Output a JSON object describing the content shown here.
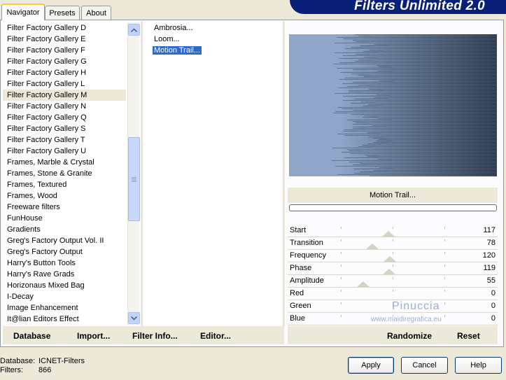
{
  "app_title": "Filters Unlimited 2.0",
  "tabs": [
    "Navigator",
    "Presets",
    "About"
  ],
  "categories": [
    "Filter Factory Gallery D",
    "Filter Factory Gallery E",
    "Filter Factory Gallery F",
    "Filter Factory Gallery G",
    "Filter Factory Gallery H",
    "Filter Factory Gallery L",
    "Filter Factory Gallery M",
    "Filter Factory Gallery N",
    "Filter Factory Gallery Q",
    "Filter Factory Gallery S",
    "Filter Factory Gallery T",
    "Filter Factory Gallery U",
    "Frames, Marble & Crystal",
    "Frames, Stone & Granite",
    "Frames, Textured",
    "Frames, Wood",
    "Freeware filters",
    "FunHouse",
    "Gradients",
    "Greg's Factory Output Vol. II",
    "Greg's Factory Output",
    "Harry's Button Tools",
    "Harry's Rave Grads",
    "Horizonaus Mixed Bag",
    "I-Decay",
    "Image Enhancement",
    "It@lian Editors Effect"
  ],
  "selected_category": "Filter Factory Gallery M",
  "filters": [
    "Ambrosia...",
    "Loom...",
    "Motion Trail..."
  ],
  "selected_filter": "Motion Trail...",
  "effect_name": "Motion Trail...",
  "params": [
    {
      "label": "Start",
      "value": "117",
      "level": 117
    },
    {
      "label": "Transition",
      "value": "78",
      "level": 78
    },
    {
      "label": "Frequency",
      "value": "120",
      "level": 120
    },
    {
      "label": "Phase",
      "value": "119",
      "level": 119
    },
    {
      "label": "Amplitude",
      "value": "55",
      "level": 55
    },
    {
      "label": "Red",
      "value": "0",
      "level": 0
    },
    {
      "label": "Green",
      "value": "0",
      "level": 0
    },
    {
      "label": "Blue",
      "value": "0",
      "level": 0
    }
  ],
  "watermark": {
    "name": "Pinuccia",
    "url": "www.maidiregrafica.eu"
  },
  "left_buttons": {
    "database": "Database",
    "import": "Import...",
    "filter_info": "Filter Info...",
    "editor": "Editor..."
  },
  "right_buttons": {
    "randomize": "Randomize",
    "reset": "Reset"
  },
  "status": {
    "database_label": "Database:",
    "database_value": "ICNET-Filters",
    "filters_label": "Filters:",
    "filters_value": "866"
  },
  "dialog_buttons": {
    "apply": "Apply",
    "cancel": "Cancel",
    "help": "Help"
  },
  "colors": {
    "banner": "#0a1f78",
    "selection": "#316ac5",
    "preview_light": "#8fa6c8",
    "preview_dark": "#27364d"
  }
}
